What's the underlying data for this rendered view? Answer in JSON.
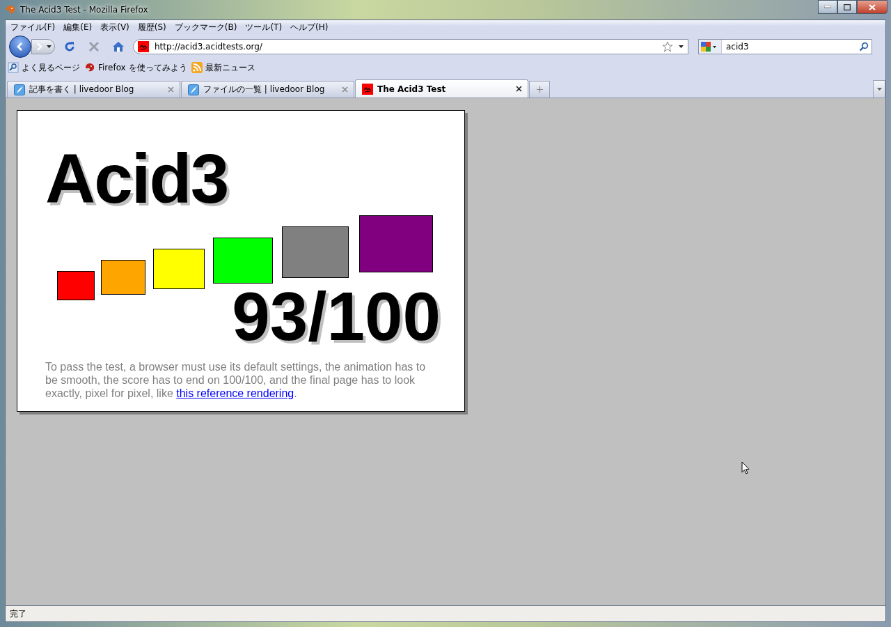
{
  "window": {
    "title": "The Acid3 Test - Mozilla Firefox"
  },
  "menu": [
    {
      "label": "ファイル(F)"
    },
    {
      "label": "編集(E)"
    },
    {
      "label": "表示(V)"
    },
    {
      "label": "履歴(S)"
    },
    {
      "label": "ブックマーク(B)"
    },
    {
      "label": "ツール(T)"
    },
    {
      "label": "ヘルプ(H)"
    }
  ],
  "address": {
    "value": "http://acid3.acidtests.org/"
  },
  "search": {
    "value": "acid3"
  },
  "bookmarks": [
    {
      "label": "よく見るページ",
      "kind": "search"
    },
    {
      "label": "Firefox を使ってみよう",
      "kind": "firefox"
    },
    {
      "label": "最新ニュース",
      "kind": "feed"
    }
  ],
  "tabs": [
    {
      "label": "記事を書く | livedoor Blog",
      "kind": "blog",
      "selected": false
    },
    {
      "label": "ファイルの一覧 | livedoor Blog",
      "kind": "blog",
      "selected": false
    },
    {
      "label": "The Acid3 Test",
      "kind": "acid",
      "selected": true
    }
  ],
  "page": {
    "title": "Acid3",
    "boxes": [
      {
        "color": "#ff0000"
      },
      {
        "color": "#ffa500"
      },
      {
        "color": "#ffff00"
      },
      {
        "color": "#00ff00"
      },
      {
        "color": "#808080"
      },
      {
        "color": "#800080"
      }
    ],
    "score": "93/100",
    "note": "To pass the test, a browser must use its default settings, the animation has to be smooth, the score has to end on 100/100, and the final page has to look exactly, pixel for pixel, like",
    "link": "this reference rendering",
    "note_end": "."
  },
  "status_bar": {
    "text": "完了"
  }
}
